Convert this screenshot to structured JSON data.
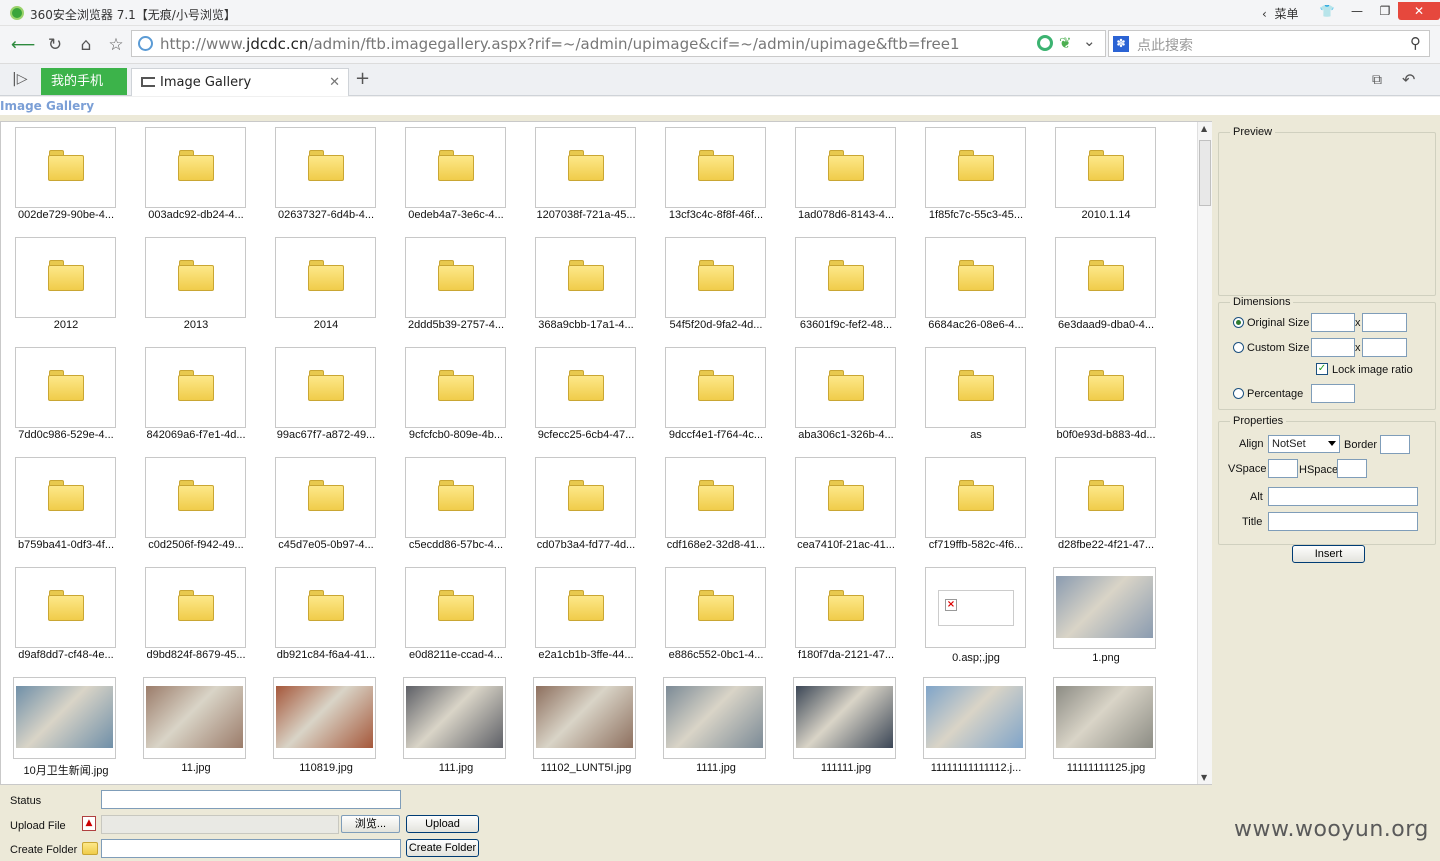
{
  "browser": {
    "title": "360安全浏览器 7.1【无痕/小号浏览】",
    "menu_label": "菜单",
    "url_base": "http://www.",
    "url_domain": "jdcdc.cn",
    "url_path": "/admin/ftb.imagegallery.aspx?rif=~/admin/upimage&cif=~/admin/upimage&ftb=free1",
    "search_placeholder": "点此搜索",
    "tabs": [
      {
        "label": "我的手机"
      },
      {
        "label": "Image Gallery"
      }
    ]
  },
  "page": {
    "heading": "Image Gallery"
  },
  "gallery": {
    "items": [
      {
        "name": "002de729-90be-4...",
        "type": "folder"
      },
      {
        "name": "003adc92-db24-4...",
        "type": "folder"
      },
      {
        "name": "02637327-6d4b-4...",
        "type": "folder"
      },
      {
        "name": "0edeb4a7-3e6c-4...",
        "type": "folder"
      },
      {
        "name": "1207038f-721a-45...",
        "type": "folder"
      },
      {
        "name": "13cf3c4c-8f8f-46f...",
        "type": "folder"
      },
      {
        "name": "1ad078d6-8143-4...",
        "type": "folder"
      },
      {
        "name": "1f85fc7c-55c3-45...",
        "type": "folder"
      },
      {
        "name": "2010.1.14",
        "type": "folder"
      },
      {
        "name": "2012",
        "type": "folder"
      },
      {
        "name": "2013",
        "type": "folder"
      },
      {
        "name": "2014",
        "type": "folder"
      },
      {
        "name": "2ddd5b39-2757-4...",
        "type": "folder"
      },
      {
        "name": "368a9cbb-17a1-4...",
        "type": "folder"
      },
      {
        "name": "54f5f20d-9fa2-4d...",
        "type": "folder"
      },
      {
        "name": "63601f9c-fef2-48...",
        "type": "folder"
      },
      {
        "name": "6684ac26-08e6-4...",
        "type": "folder"
      },
      {
        "name": "6e3daad9-dba0-4...",
        "type": "folder"
      },
      {
        "name": "7dd0c986-529e-4...",
        "type": "folder"
      },
      {
        "name": "842069a6-f7e1-4d...",
        "type": "folder"
      },
      {
        "name": "99ac67f7-a872-49...",
        "type": "folder"
      },
      {
        "name": "9cfcfcb0-809e-4b...",
        "type": "folder"
      },
      {
        "name": "9cfecc25-6cb4-47...",
        "type": "folder"
      },
      {
        "name": "9dccf4e1-f764-4c...",
        "type": "folder"
      },
      {
        "name": "aba306c1-326b-4...",
        "type": "folder"
      },
      {
        "name": "as",
        "type": "folder"
      },
      {
        "name": "b0f0e93d-b883-4d...",
        "type": "folder"
      },
      {
        "name": "b759ba41-0df3-4f...",
        "type": "folder"
      },
      {
        "name": "c0d2506f-f942-49...",
        "type": "folder"
      },
      {
        "name": "c45d7e05-0b97-4...",
        "type": "folder"
      },
      {
        "name": "c5ecdd86-57bc-4...",
        "type": "folder"
      },
      {
        "name": "cd07b3a4-fd77-4d...",
        "type": "folder"
      },
      {
        "name": "cdf168e2-32d8-41...",
        "type": "folder"
      },
      {
        "name": "cea7410f-21ac-41...",
        "type": "folder"
      },
      {
        "name": "cf719ffb-582c-4f6...",
        "type": "folder"
      },
      {
        "name": "d28fbe22-4f21-47...",
        "type": "folder"
      },
      {
        "name": "d9af8dd7-cf48-4e...",
        "type": "folder"
      },
      {
        "name": "d9bd824f-8679-45...",
        "type": "folder"
      },
      {
        "name": "db921c84-f6a4-41...",
        "type": "folder"
      },
      {
        "name": "e0d8211e-ccad-4...",
        "type": "folder"
      },
      {
        "name": "e2a1cb1b-3ffe-44...",
        "type": "folder"
      },
      {
        "name": "e886c552-0bc1-4...",
        "type": "folder"
      },
      {
        "name": "f180f7da-2121-47...",
        "type": "folder"
      },
      {
        "name": "0.asp;.jpg",
        "type": "broken"
      },
      {
        "name": "1.png",
        "type": "image",
        "color": "#8a9bb0"
      },
      {
        "name": "10月卫生新闻.jpg",
        "type": "image",
        "color": "#6f8fa8"
      },
      {
        "name": "11.jpg",
        "type": "image",
        "color": "#9b7c6a"
      },
      {
        "name": "110819.jpg",
        "type": "image",
        "color": "#a5573a"
      },
      {
        "name": "111.jpg",
        "type": "image",
        "color": "#5d5f66"
      },
      {
        "name": "11102_LUNT5I.jpg",
        "type": "image",
        "color": "#8d6f5e"
      },
      {
        "name": "1111.jpg",
        "type": "image",
        "color": "#7b8a96"
      },
      {
        "name": "111111.jpg",
        "type": "image",
        "color": "#3b4656"
      },
      {
        "name": "11111111111112.j...",
        "type": "image",
        "color": "#7fa4c9"
      },
      {
        "name": "11111111125.jpg",
        "type": "image",
        "color": "#8c8c84"
      }
    ]
  },
  "panel": {
    "preview_legend": "Preview",
    "dimensions_legend": "Dimensions",
    "original_size": "Original Size",
    "custom_size": "Custom Size",
    "times": "x",
    "lock_ratio": "Lock image ratio",
    "percentage": "Percentage",
    "properties_legend": "Properties",
    "align_label": "Align",
    "align_value": "NotSet",
    "border_label": "Border",
    "vspace_label": "VSpace",
    "hspace_label": "HSpace",
    "alt_label": "Alt",
    "title_label": "Title",
    "insert_button": "Insert"
  },
  "footer": {
    "status_label": "Status",
    "upload_label": "Upload File",
    "browse_button": "浏览...",
    "upload_button": "Upload",
    "create_folder_label": "Create Folder",
    "create_folder_button": "Create Folder"
  },
  "watermark": "www.wooyun.org"
}
